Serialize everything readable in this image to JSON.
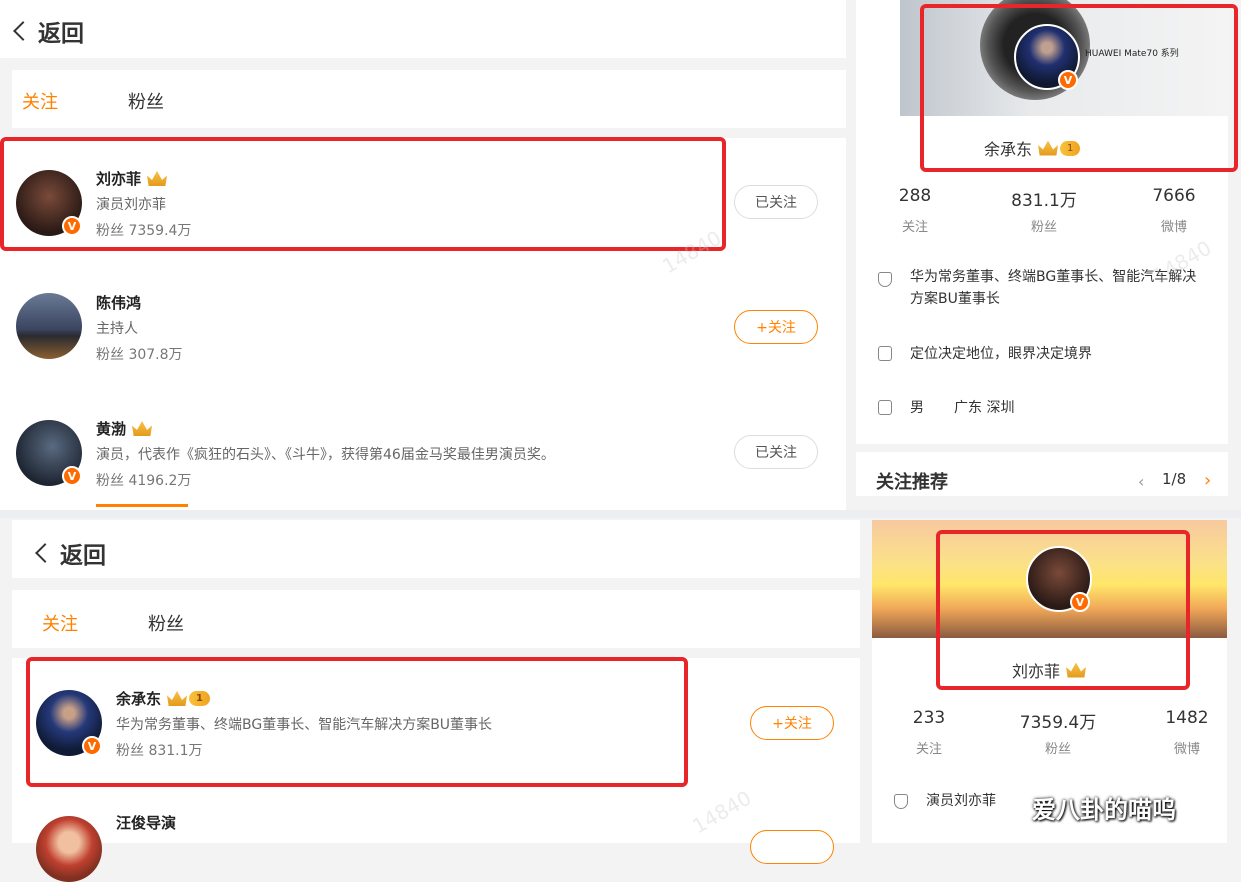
{
  "top": {
    "back_label": "返回",
    "tabs": [
      {
        "label": "关注"
      },
      {
        "label": "粉丝"
      }
    ],
    "rows": [
      {
        "name": "刘亦菲",
        "desc": "演员刘亦菲",
        "fans": "粉丝 7359.4万",
        "button": "已关注"
      },
      {
        "name": "陈伟鸿",
        "desc": "主持人",
        "fans": "粉丝 307.8万",
        "button": "+关注"
      },
      {
        "name": "黄渤",
        "desc": "演员，代表作《疯狂的石头》、《斗牛》，获得第46届金马奖最佳男演员奖。",
        "fans": "粉丝 4196.2万",
        "button": "已关注"
      }
    ],
    "profile": {
      "banner_text": "HUAWEI Mate70 系列",
      "name": "余承东",
      "level": "1",
      "stats": [
        {
          "num": "288",
          "label": "关注"
        },
        {
          "num": "831.1万",
          "label": "粉丝"
        },
        {
          "num": "7666",
          "label": "微博"
        }
      ],
      "title": "华为常务董事、终端BG董事长、智能汽车解决方案BU董事长",
      "motto": "定位决定地位，眼界决定境界",
      "gender": "男",
      "location": "广东 深圳",
      "recommend_label": "关注推荐",
      "pager": "1/8"
    }
  },
  "bottom": {
    "back_label": "返回",
    "tabs": [
      {
        "label": "关注"
      },
      {
        "label": "粉丝"
      }
    ],
    "rows": [
      {
        "name": "余承东",
        "level": "1",
        "desc": "华为常务董事、终端BG董事长、智能汽车解决方案BU董事长",
        "fans": "粉丝 831.1万",
        "button": "+关注"
      },
      {
        "name": "汪俊导演"
      }
    ],
    "profile": {
      "name": "刘亦菲",
      "stats": [
        {
          "num": "233",
          "label": "关注"
        },
        {
          "num": "7359.4万",
          "label": "粉丝"
        },
        {
          "num": "1482",
          "label": "微博"
        }
      ],
      "desc": "演员刘亦菲"
    }
  },
  "watermark_text": "14840",
  "corner_watermark": "爱八卦的喵呜",
  "colors": {
    "accent": "#ff8200",
    "highlight_box": "#e8262a",
    "verified_badge": "#ff6a00"
  }
}
